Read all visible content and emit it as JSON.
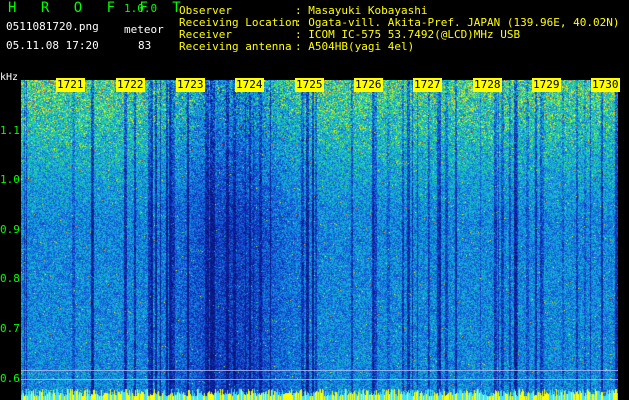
{
  "header": {
    "app_title": "H R O F F T",
    "version": "1.0.0",
    "filename": "0511081720.png",
    "mode": "meteor",
    "datetime": "05.11.08 17:20",
    "count": "83",
    "info": [
      {
        "label": "Observer",
        "value": ": Masayuki Kobayashi"
      },
      {
        "label": "Receiving Location",
        "value": ": Ogata-vill. Akita-Pref. JAPAN (139.96E, 40.02N)"
      },
      {
        "label": "Receiver",
        "value": ": ICOM IC-575 53.7492(@LCD)MHz USB"
      },
      {
        "label": "Receiving antenna",
        "value": ": A504HB(yagi 4el)"
      }
    ]
  },
  "spectrogram": {
    "y_unit": "kHz",
    "y_ticks": [
      "1.1",
      "1.0",
      "0.9",
      "0.8",
      "0.7",
      "0.6"
    ],
    "time_ticks": [
      "1721",
      "1722",
      "1723",
      "1724",
      "1725",
      "1726",
      "1727",
      "1728",
      "1729",
      "1730"
    ],
    "colors": {
      "background": "#0a1a8c",
      "low": "#1030c0",
      "mid": "#10b0e0",
      "high": "#30e070",
      "peak": "#ffff00",
      "label": "#00ff00"
    }
  }
}
